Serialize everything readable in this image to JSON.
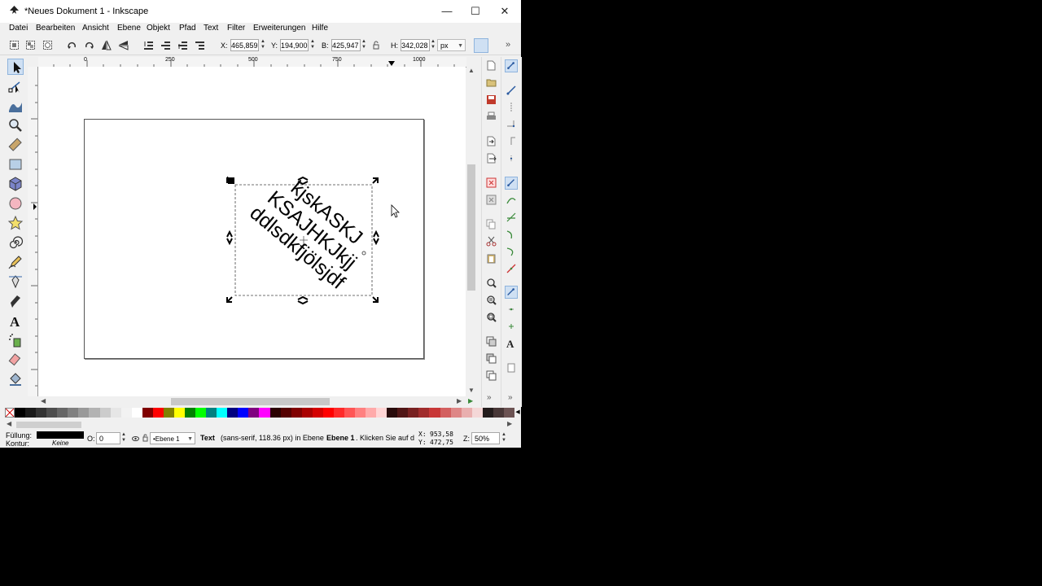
{
  "window": {
    "title": "*Neues Dokument 1 - Inkscape",
    "minimize": "—",
    "maximize": "☐",
    "close": "✕"
  },
  "menu": [
    "Datei",
    "Bearbeiten",
    "Ansicht",
    "Ebene",
    "Objekt",
    "Pfad",
    "Text",
    "Filter",
    "Erweiterungen",
    "Hilfe"
  ],
  "toolbar": {
    "x_label": "X:",
    "x_value": "465,859",
    "y_label": "Y:",
    "y_value": "194,900",
    "w_label": "B:",
    "w_value": "425,947",
    "h_label": "H:",
    "h_value": "342,028",
    "unit": "px",
    "more": "»"
  },
  "ruler": {
    "labels": [
      "0",
      "250",
      "500",
      "750",
      "1000"
    ]
  },
  "canvas_text": {
    "line1": "kjskASKJ",
    "line2": "KSAJHKJkjj",
    "line3": "ddlsdkfjölsjdf",
    "rotation_deg": 40
  },
  "palette": [
    "#000000",
    "#1a1a1a",
    "#333333",
    "#4d4d4d",
    "#666666",
    "#808080",
    "#999999",
    "#b3b3b3",
    "#cccccc",
    "#e6e6e6",
    "#f2f2f2",
    "#ffffff",
    "#800000",
    "#ff0000",
    "#808000",
    "#ffff00",
    "#008000",
    "#00ff00",
    "#008080",
    "#00ffff",
    "#000080",
    "#0000ff",
    "#800080",
    "#ff00ff",
    "#2b0000",
    "#550000",
    "#800000",
    "#aa0000",
    "#d40000",
    "#ff0000",
    "#ff2a2a",
    "#ff5555",
    "#ff8080",
    "#ffaaaa",
    "#ffd5d5",
    "#280b0b",
    "#501616",
    "#782121",
    "#a02c2c",
    "#c83737",
    "#d35f5f",
    "#de8787",
    "#e9afaf",
    "#f4d7d7",
    "#241c1c",
    "#483737",
    "#6c5353"
  ],
  "status": {
    "fill_label": "Füllung:",
    "stroke_label": "Kontur:",
    "stroke_value": "Keine",
    "opacity_label": "O:",
    "opacity_value": "0",
    "layer": "•Ebene 1",
    "message_type": "Text",
    "message_detail": "(sans-serif, 118.36 px) in Ebene",
    "message_layer": "Ebene 1",
    "message_rest": ". Klicken Sie auf d",
    "coord_x_label": "X:",
    "coord_x": "953,58",
    "coord_y_label": "Y:",
    "coord_y": "472,75",
    "zoom_label": "Z:",
    "zoom": "50%"
  }
}
